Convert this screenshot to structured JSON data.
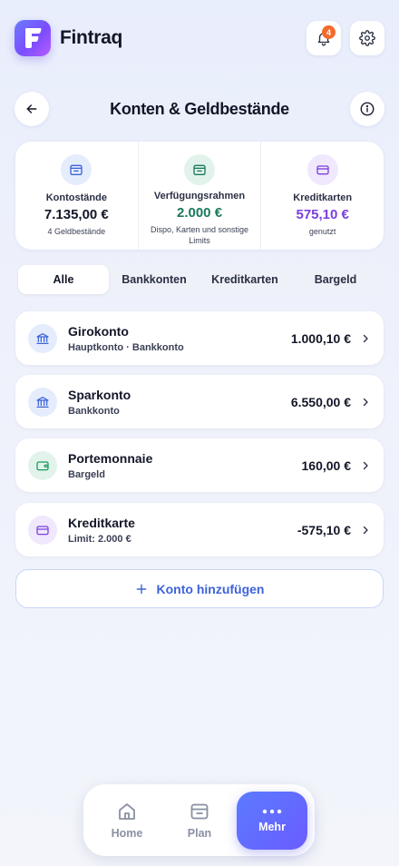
{
  "app": {
    "brand": "Fintraq",
    "logo_letter": "F",
    "notification_count": "4"
  },
  "header": {
    "title": "Konten & Geldbestände"
  },
  "summary": [
    {
      "label": "Kontostände",
      "value": "7.135,00 €",
      "sub": "4 Geldbestände",
      "color": "#121627",
      "icon": "wallet-icon"
    },
    {
      "label": "Verfügungsrahmen",
      "value": "2.000 €",
      "sub": "Dispo, Karten und sonstige Limits",
      "color": "#1a7a5c",
      "icon": "wallet-icon"
    },
    {
      "label": "Kreditkarten",
      "value": "575,10 €",
      "sub": "genutzt",
      "color": "#7a3fe0",
      "icon": "credit-card-icon"
    }
  ],
  "tabs": [
    {
      "label": "Alle",
      "active": true
    },
    {
      "label": "Bankkonten"
    },
    {
      "label": "Kreditkarten"
    },
    {
      "label": "Bargeld"
    }
  ],
  "accounts": [
    {
      "name": "Girokonto",
      "sub": "Hauptkonto · Bankkonto",
      "amount": "1.000,10 €",
      "icon": "bank-icon"
    },
    {
      "name": "Sparkonto",
      "sub": "Bankkonto",
      "amount": "6.550,00 €",
      "icon": "bank-icon"
    },
    {
      "name": "Portemonnaie",
      "sub": "Bargeld",
      "amount": "160,00 €",
      "icon": "wallet-icon"
    },
    {
      "name": "Kreditkarte",
      "sub": "Limit: 2.000 €",
      "amount": "-575,10 €",
      "icon": "credit-card-icon"
    }
  ],
  "add_account_label": "Konto hinzufügen",
  "nav": [
    {
      "label": "Home",
      "icon": "home-icon"
    },
    {
      "label": "Plan",
      "icon": "plan-icon"
    },
    {
      "label": "Mehr",
      "icon": "more-icon",
      "active": true
    }
  ],
  "colors": {
    "accent": "#3d63d8",
    "green": "#1a7a5c",
    "purple": "#7a3fe0",
    "badge": "#f26a2e"
  }
}
